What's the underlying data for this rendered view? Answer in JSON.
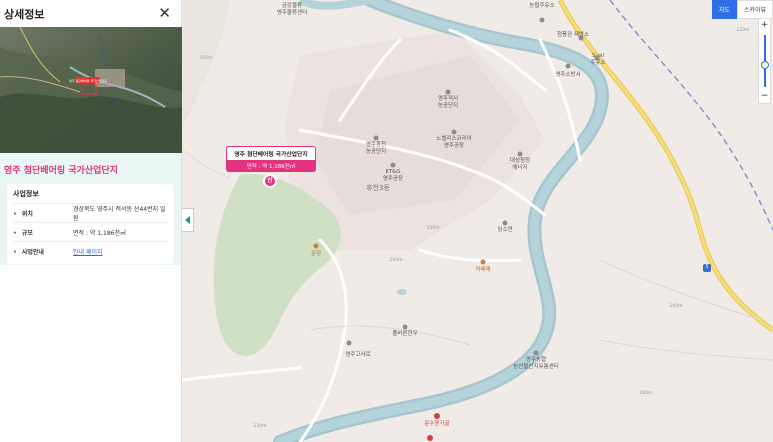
{
  "panel": {
    "title": "상세정보",
    "close_label": "✕",
    "project_name": "영주 첨단베어링 국가산업단지",
    "section_title": "사업정보",
    "rows": [
      {
        "key": "위치",
        "value": "경상북도 영주시 적서동 산44번지 일원"
      },
      {
        "key": "규모",
        "value": "면적 : 약 1,186천㎡"
      },
      {
        "key": "사업안내",
        "value": "안내 페이지"
      }
    ]
  },
  "thumbnail": {
    "label": "영주 첨단베어링 국가산업단지"
  },
  "map_controls": {
    "map_label": "지도",
    "skyview_label": "스카이뷰",
    "zoom_in": "+",
    "zoom_out": "−"
  },
  "callout": {
    "title": "영주 첨단베어링 국가산업단지",
    "area": "면적 : 약 1,186천㎡",
    "marker_text": "산"
  },
  "map_labels": {
    "top_center": "금강물류\n영주물류센터",
    "gas": "농협주유소",
    "jaeyang": "청풍관 제방소",
    "soil": "S-oil\n주유소",
    "fire": "영주소방서",
    "sunset": "영주적서\n농공단지",
    "nh_complex": "영주휴천\n농공단지",
    "novelis": "노벨리스코리아\n영주공장",
    "ktg": "KT&G\n영주공장",
    "daesung": "대성청정\n에너지",
    "hyucheon3": "휴천3동",
    "imsoyeon": "임소연",
    "munjeong": "문정",
    "yakbong": "약배재",
    "jolbaeg": "졸바른한우",
    "youngju_gosaro": "영주고사로",
    "nonghyup": "영주농협\n농산물산지유통센터",
    "mun_sul": "문수윤가골",
    "road_number": "5",
    "contour_1": "200m",
    "contour_2": "150m",
    "contour_3": "200m",
    "contour_4": "160m",
    "contour_5": "220m",
    "contour_6": "200m",
    "contour_7": "130m"
  }
}
